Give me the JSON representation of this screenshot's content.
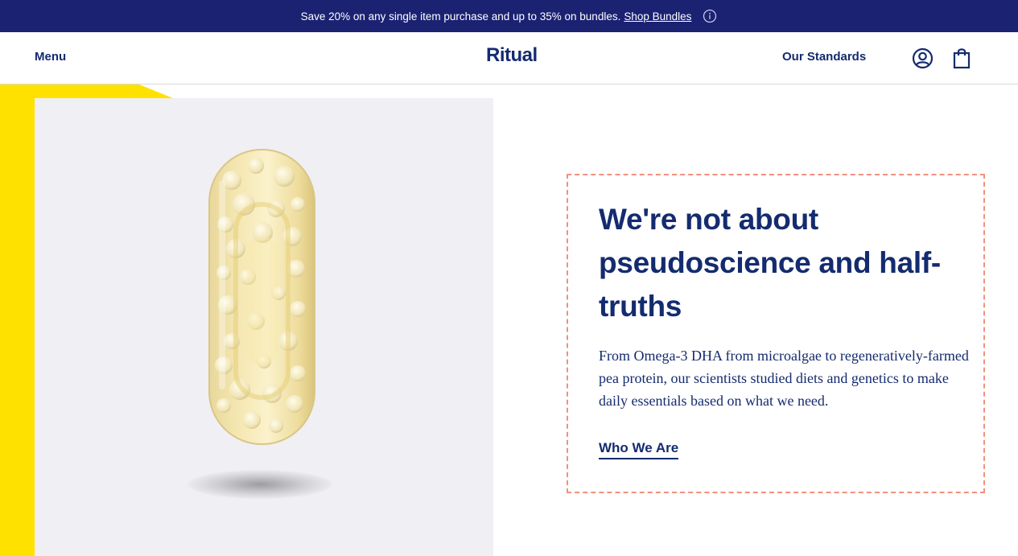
{
  "promo": {
    "message": "Save 20% on any single item purchase and up to 35% on bundles.",
    "link_label": "Shop Bundles",
    "icon": "info-icon"
  },
  "header": {
    "menu_label": "Menu",
    "logo_text": "Ritual",
    "standards_label": "Our Standards",
    "account_icon": "account-icon",
    "cart_icon": "shopping-bag-icon"
  },
  "hero": {
    "image_subject": "capsule-image",
    "headline": "We're not about pseudoscience and half-truths",
    "body": "From Omega-3 DHA from microalgae to regeneratively-farmed pea protein, our scientists studied diets and genetics to make daily essentials based on what we need.",
    "cta_label": "Who We Are"
  },
  "colors": {
    "navy": "#1b2272",
    "text_navy": "#142b6f",
    "accent_yellow": "#ffe100",
    "dashed_border": "#f2907e",
    "image_bg": "#f0eff3"
  }
}
